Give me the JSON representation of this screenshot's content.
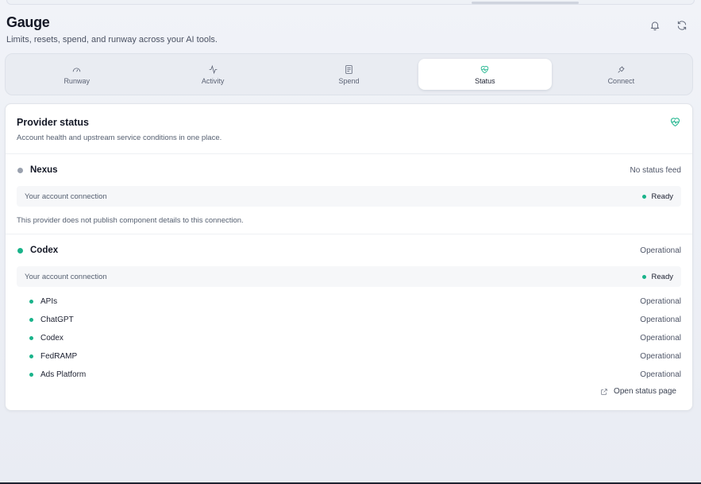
{
  "app": {
    "title": "Gauge",
    "subtitle": "Limits, resets, spend, and runway across your AI tools.",
    "header_icons": [
      "bell-icon",
      "refresh-icon"
    ]
  },
  "tabs": [
    {
      "label": "Runway",
      "icon": "gauge-icon",
      "active": false
    },
    {
      "label": "Activity",
      "icon": "activity-icon",
      "active": false
    },
    {
      "label": "Spend",
      "icon": "receipt-icon",
      "active": false
    },
    {
      "label": "Status",
      "icon": "heart-pulse-icon",
      "active": true
    },
    {
      "label": "Connect",
      "icon": "plug-icon",
      "active": false
    }
  ],
  "card": {
    "title": "Provider status",
    "subtitle": "Account health and upstream service conditions in one place.",
    "icon": "heart-pulse-icon"
  },
  "providers": [
    {
      "name": "Nexus",
      "status": "No status feed",
      "dot_color": "#9aa1ae",
      "account_label": "Your account connection",
      "account_status": "Ready",
      "note": "This provider does not publish component details to this connection."
    },
    {
      "name": "Codex",
      "status": "Operational",
      "dot_color": "#19b38a",
      "account_label": "Your account connection",
      "account_status": "Ready",
      "components": [
        {
          "name": "APIs",
          "status": "Operational"
        },
        {
          "name": "ChatGPT",
          "status": "Operational"
        },
        {
          "name": "Codex",
          "status": "Operational"
        },
        {
          "name": "FedRAMP",
          "status": "Operational"
        },
        {
          "name": "Ads Platform",
          "status": "Operational"
        }
      ]
    }
  ],
  "open_status_label": "Open status page",
  "colors": {
    "accent": "#19b38a",
    "neutral_dot": "#9aa1ae"
  }
}
